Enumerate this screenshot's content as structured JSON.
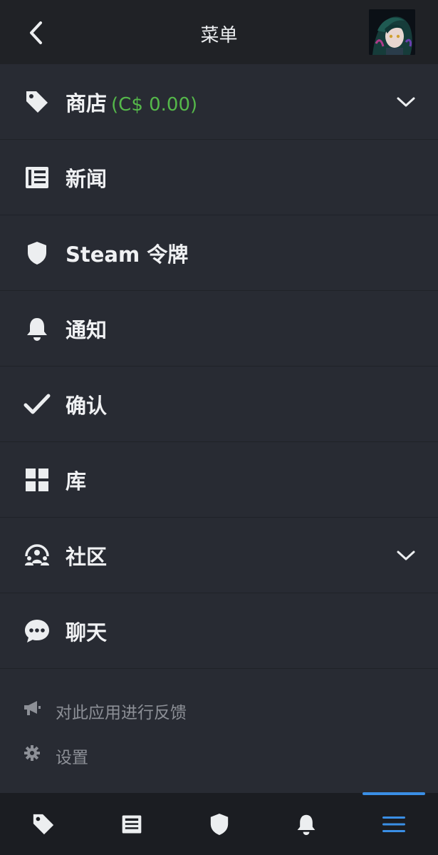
{
  "header": {
    "title": "菜单"
  },
  "menu": {
    "items": [
      {
        "label": "商店",
        "suffix": "(C$ 0.00)",
        "icon": "tag-icon",
        "expandable": true
      },
      {
        "label": "新闻",
        "icon": "newspaper-icon"
      },
      {
        "label": "Steam 令牌",
        "icon": "shield-icon"
      },
      {
        "label": "通知",
        "icon": "bell-icon"
      },
      {
        "label": "确认",
        "icon": "checkmark-icon"
      },
      {
        "label": "库",
        "icon": "grid-icon"
      },
      {
        "label": "社区",
        "icon": "community-icon",
        "expandable": true
      },
      {
        "label": "聊天",
        "icon": "chat-icon"
      }
    ]
  },
  "secondary": {
    "items": [
      {
        "label": "对此应用进行反馈",
        "icon": "megaphone-icon"
      },
      {
        "label": "设置",
        "icon": "gear-icon"
      }
    ]
  },
  "bottom_nav": {
    "items": [
      {
        "icon": "tag-icon"
      },
      {
        "icon": "newspaper-icon"
      },
      {
        "icon": "shield-icon"
      },
      {
        "icon": "bell-icon"
      },
      {
        "icon": "menu-icon",
        "active": true
      }
    ]
  },
  "colors": {
    "background": "#282b33",
    "header": "#202226",
    "nav": "#1b1d22",
    "accent_green": "#55b84a",
    "accent_blue": "#3a8fe6",
    "muted_text": "#8d9097"
  }
}
